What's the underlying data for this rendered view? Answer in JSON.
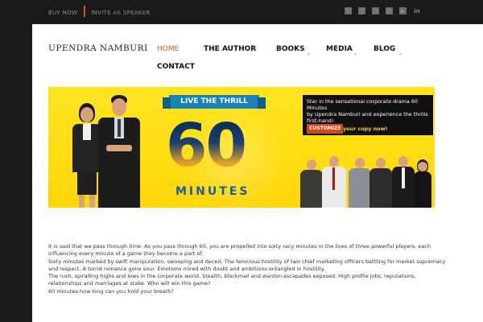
{
  "topbar": {
    "buy_now": "BUY NOW",
    "invite": "INVITE AS SPEAKER",
    "social_icons": [
      "twitter-icon",
      "facebook-icon",
      "rss-icon",
      "email-icon",
      "youtube-icon",
      "linkedin-icon"
    ],
    "linkedin_label": "in",
    "accent": "#d8551e"
  },
  "logo": "UPENDRA NAMBURI",
  "nav": {
    "home": "HOME",
    "author": "THE AUTHOR",
    "books": "BOOKS",
    "media": "MEDIA",
    "blog": "BLOG",
    "contact": "CONTACT"
  },
  "banner": {
    "ribbon": "LIVE THE THRILL",
    "big_number": "60",
    "minutes_label": "MINUTES",
    "promo_line1": "Star in the sensational corporate drama 60 Minutes",
    "promo_line2": "by Upendra Namburi and experience the thrills first-hand!",
    "customize": "CUSTOMIZE",
    "promo_copy": "your copy now!",
    "background": "#ffe521"
  },
  "body_text": [
    "It is said that we pass through time. As you pass through 60, you are propelled into sixty racy minutes in the lives of three powerful players, each influencing every minute of a game they become a part of.",
    "Sixty minutes marked by swift manipulation, swooping and deceit. The ferocious hostility of two chief marketing officers battling for market supremacy and respect. A torrid romance gone sour. Emotions mired with doubt and ambitions entangled in hostility.",
    "The rush, spiralling highs and lows in the corporate world. Stealth, blackmail and wanton escapades exposed. High profile jobs, reputations, relationships and marriages at stake. Who will win this game?",
    "60 minutes-how long can you hold your breath?"
  ]
}
